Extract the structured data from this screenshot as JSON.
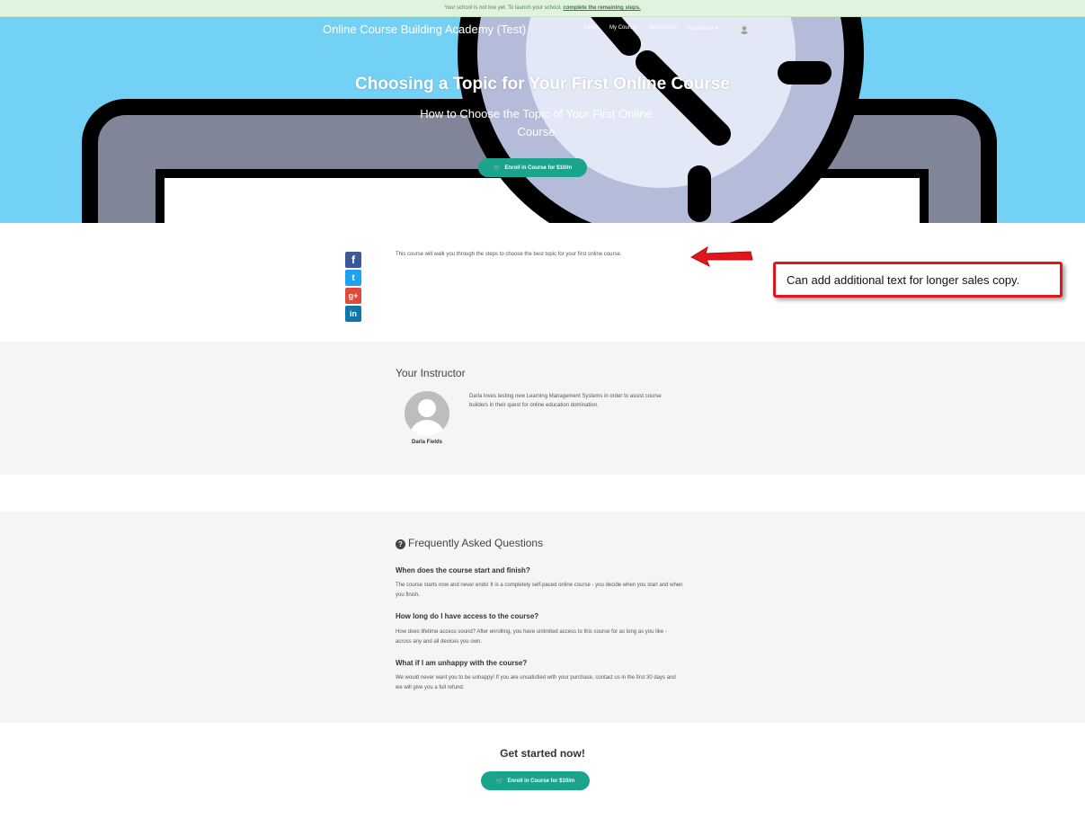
{
  "notice": {
    "text": "Your school is not live yet. To launch your school,",
    "link": "complete the remaining steps."
  },
  "header": {
    "brand": "Online Course Building Academy (Test)",
    "nav": [
      "Admin",
      "My Courses",
      "All Courses",
      "Preview as ▾"
    ]
  },
  "hero": {
    "title": "Choosing a Topic for Your First Online Course",
    "subtitle": "How to Choose the Topic of Your First Online Course",
    "enroll_label": "Enroll in Course for $10/m"
  },
  "description": {
    "text": "This course will walk you through the steps to choose the best topic for your first online course."
  },
  "social": {
    "facebook": "f",
    "twitter": "t",
    "googleplus": "g+",
    "linkedin": "in"
  },
  "annotation": {
    "text": "Can add additional text for longer sales copy.",
    "color": "#e0161c"
  },
  "instructor": {
    "heading": "Your Instructor",
    "name": "Darla Fields",
    "bio": "Darla loves testing new Learning Management Systems in order to assist course builders in their quest for online education domination."
  },
  "faq": {
    "heading": "Frequently Asked Questions",
    "items": [
      {
        "q": "When does the course start and finish?",
        "a": "The course starts now and never ends! It is a completely self-paced online course - you decide when you start and when you finish."
      },
      {
        "q": "How long do I have access to the course?",
        "a": "How does lifetime access sound? After enrolling, you have unlimited access to this course for as long as you like - across any and all devices you own."
      },
      {
        "q": "What if I am unhappy with the course?",
        "a": "We would never want you to be unhappy! If you are unsatisfied with your purchase, contact us in the first 30 days and we will give you a full refund."
      }
    ]
  },
  "cta": {
    "heading": "Get started now!",
    "enroll_label": "Enroll in Course for $10/m"
  },
  "colors": {
    "hero_bg": "#74d1f6",
    "button": "#1aa48c",
    "band_bg": "#f5f5f5"
  }
}
